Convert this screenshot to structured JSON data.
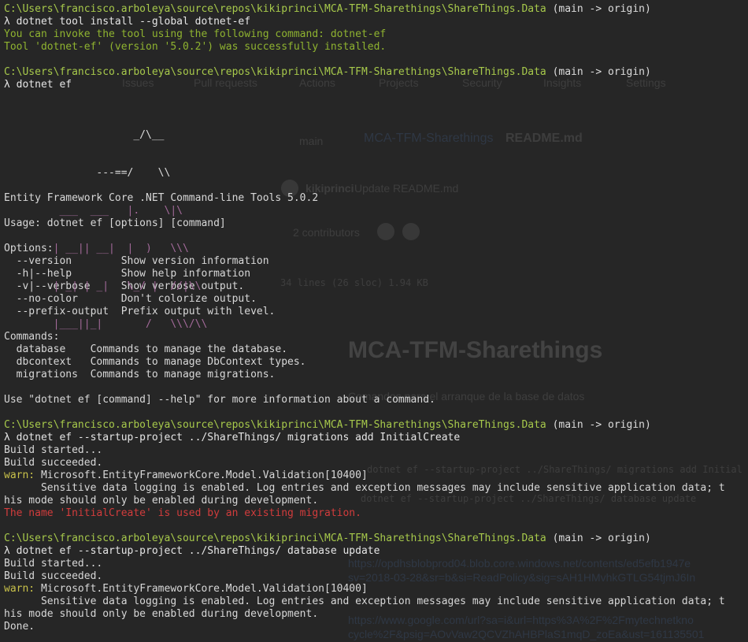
{
  "ghost": {
    "tabs": [
      "Issues",
      "Pull requests",
      "Actions",
      "Projects",
      "Security",
      "Insights",
      "Settings"
    ],
    "branch": "main",
    "repo": "MCA-TFM-Sharethings",
    "file": "README.md",
    "commit_user": "kikiprinci",
    "commit_msg": "Update README.md",
    "contributors": "2 contributors",
    "file_info": "34 lines (26 sloc)   1.94 KB",
    "heading": "MCA-TFM-Sharethings",
    "subtitle": "Comandos para el arranque de la base de datos",
    "code1": "dotnet ef --startup-project ../ShareThings/ migrations add Initial",
    "code2": "dotnet ef --startup-project ../ShareThings/ database update",
    "link1": "https://opdhsblobprod04.blob.core.windows.net/contents/ed5efb1947e",
    "link2": "sv=2018-03-28&sr=b&si=ReadPolicy&sig=sAH1HMvhkGTLG54tjmJ6In",
    "link3": "https://www.google.com/url?sa=i&url=https%3A%2F%2Fmytechnetkno",
    "link4": "cycle%2F&psig=AOvVaw2QCVZhAHBPlaS1mqD_zoEa&ust=161135501"
  },
  "terminal": {
    "prompt_path": "C:\\Users\\francisco.arboleya\\source\\repos\\kikiprinci\\MCA-TFM-Sharethings\\ShareThings.Data",
    "prompt_branch": " (main -> origin)",
    "cmd1": "λ dotnet tool install --global dotnet-ef",
    "out1a": "You can invoke the tool using the following command: dotnet-ef",
    "out1b": "Tool 'dotnet-ef' (version '5.0.2') was successfully installed.",
    "cmd2": "λ dotnet ef",
    "logo": [
      "                     _/\\__",
      "               ---==/    \\\\",
      "         ___  ___   |.    \\|\\",
      "        | __|| __|  |  )   \\\\\\",
      "        | _| | _|   \\_/ |  //|\\\\",
      "        |___||_|       /   \\\\\\/\\\\"
    ],
    "title": "Entity Framework Core .NET Command-line Tools 5.0.2",
    "usage": "Usage: dotnet ef [options] [command]",
    "options_header": "Options:",
    "options": [
      "  --version        Show version information",
      "  -h|--help        Show help information",
      "  -v|--verbose     Show verbose output.",
      "  --no-color       Don't colorize output.",
      "  --prefix-output  Prefix output with level."
    ],
    "commands_header": "Commands:",
    "commands": [
      "  database    Commands to manage the database.",
      "  dbcontext   Commands to manage DbContext types.",
      "  migrations  Commands to manage migrations."
    ],
    "help_hint": "Use \"dotnet ef [command] --help\" for more information about a command.",
    "cmd3": "λ dotnet ef --startup-project ../ShareThings/ migrations add InitialCreate",
    "build_started": "Build started...",
    "build_succeeded": "Build succeeded.",
    "warn_label": "warn:",
    "warn_text": " Microsoft.EntityFrameworkCore.Model.Validation[10400]",
    "sensitive1": "      Sensitive data logging is enabled. Log entries and exception messages may include sensitive application data; t",
    "sensitive2": "his mode should only be enabled during development.",
    "error_msg": "The name 'InitialCreate' is used by an existing migration.",
    "cmd4": "λ dotnet ef --startup-project ../ShareThings/ database update",
    "done": "Done."
  }
}
